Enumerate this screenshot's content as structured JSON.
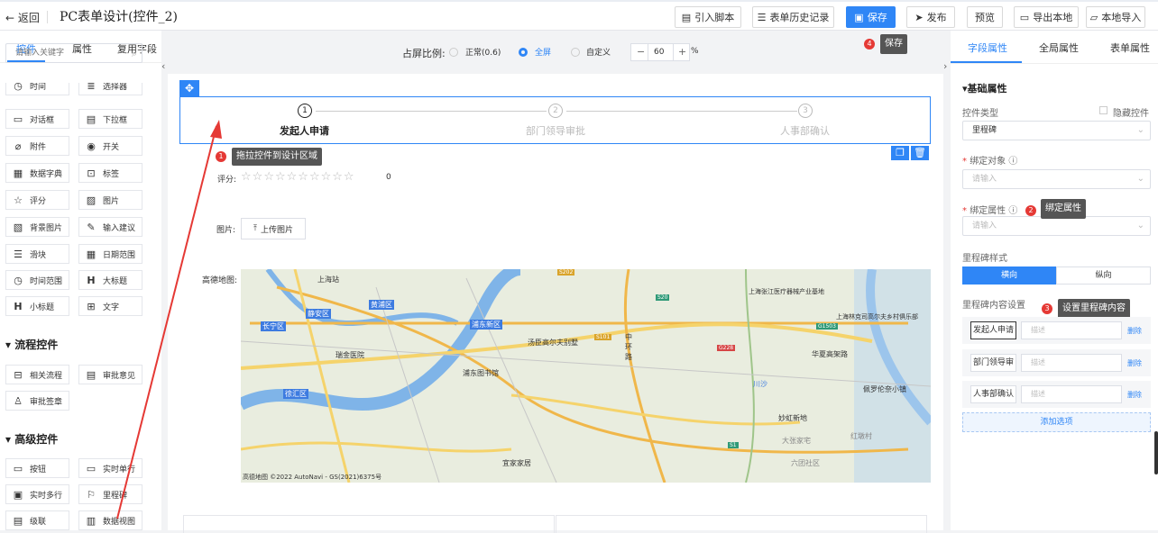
{
  "topbar": {
    "back": "← 返回",
    "title": "PC表单设计(控件_2)",
    "buttons": {
      "import_script": "引入脚本",
      "history": "表单历史记录",
      "save": "保存",
      "publish": "发布",
      "preview": "预览",
      "export": "导出本地",
      "import_local": "本地导入"
    }
  },
  "left_panel": {
    "tabs": [
      "控件",
      "属性",
      "复用字段"
    ],
    "search_placeholder": "请输入关键字",
    "basic_items": [
      [
        "时间",
        "选择器"
      ],
      [
        "对话框",
        "下拉框"
      ],
      [
        "附件",
        "开关"
      ],
      [
        "数据字典",
        "标签"
      ],
      [
        "评分",
        "图片"
      ],
      [
        "背景图片",
        "输入建议"
      ],
      [
        "滑块",
        "日期范围"
      ],
      [
        "时间范围",
        "大标题"
      ],
      [
        "小标题",
        "文字"
      ]
    ],
    "flow_section": "流程控件",
    "flow_items": [
      "相关流程",
      "审批意见",
      "审批签章"
    ],
    "advanced_section": "高级控件",
    "advanced_items": [
      "按钮",
      "实时单行",
      "实时多行",
      "里程碑",
      "级联",
      "数据视图"
    ]
  },
  "ratio_bar": {
    "label": "占屏比例:",
    "options": [
      "正常(0.6)",
      "全屏",
      "自定义"
    ],
    "selected": "全屏",
    "minus": "−",
    "value": "60",
    "plus": "+",
    "unit": "%"
  },
  "milestone": {
    "steps": [
      {
        "num": "1",
        "label": "发起人申请",
        "active": true
      },
      {
        "num": "2",
        "label": "部门领导审批",
        "active": false
      },
      {
        "num": "3",
        "label": "人事部确认",
        "active": false
      }
    ]
  },
  "annotations": {
    "tip1": "拖拉控件到设计区域",
    "tip2": "绑定属性",
    "tip3": "设置里程碑内容",
    "tip4": "保存",
    "badges": [
      "1",
      "2",
      "3",
      "4"
    ]
  },
  "fields": {
    "rating_label": "评分:",
    "rating_value": "0",
    "rating_stars": 10,
    "image_label": "图片:",
    "upload_button": "上传图片",
    "map_label": "高德地图:",
    "map_labels": [
      "上海站",
      "静安区",
      "黄浦区",
      "长宁区",
      "瑞金医院",
      "徐汇区",
      "浦东新区",
      "汤臣高尔夫别墅",
      "浦东图书馆",
      "上海张江医疗器械产业基地",
      "上海林克司高尔夫乡村俱乐部",
      "华夏高架路",
      "佩罗伦奈小镇",
      "妙虹新地",
      "宜家家居",
      "大张家宅",
      "红墩村",
      "六团社区",
      "中环路",
      "川沙",
      "S20",
      "S202",
      "S101",
      "G228",
      "G1503",
      "S1",
      "高德地图 ©2022 AutoNavi - GS(2021)6375号"
    ]
  },
  "right_panel": {
    "tabs": [
      "字段属性",
      "全局属性",
      "表单属性"
    ],
    "section": "基础属性",
    "control_type_label": "控件类型",
    "hide_control": "隐藏控件",
    "control_type_value": "里程碑",
    "bind_object_label": "绑定对象",
    "bind_object_placeholder": "请输入",
    "bind_attr_label": "绑定属性",
    "bind_attr_placeholder": "请输入",
    "style_label": "里程碑样式",
    "style_options": [
      "横向",
      "纵向"
    ],
    "style_selected": "横向",
    "content_label": "里程碑内容设置",
    "rows": [
      {
        "label": "发起人申请",
        "desc_placeholder": "描述",
        "delete": "删除"
      },
      {
        "label": "部门领导审批",
        "desc_placeholder": "描述",
        "delete": "删除"
      },
      {
        "label": "人事部确认",
        "desc_placeholder": "描述",
        "delete": "删除"
      }
    ],
    "add_option": "添加选项"
  },
  "colors": {
    "accent": "#2f86f6",
    "badge": "#e53935",
    "arrow": "#e53935",
    "tooltip": "#555555"
  }
}
